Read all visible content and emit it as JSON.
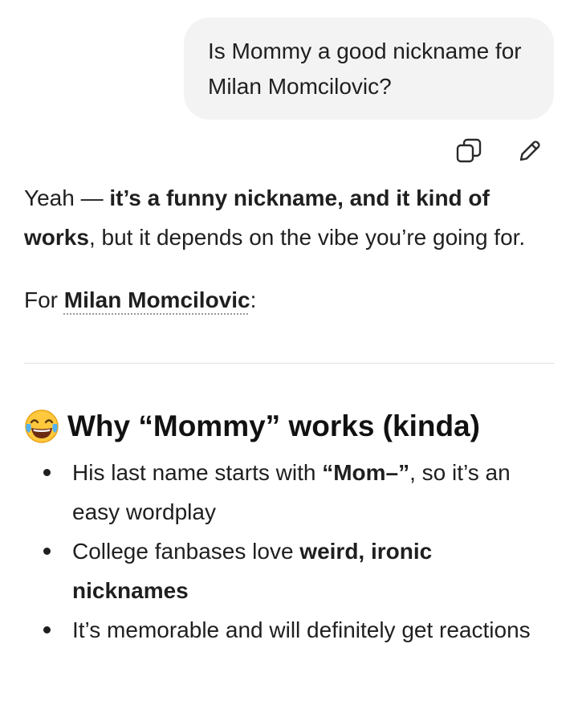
{
  "user_message": {
    "text": "Is Mommy a good nickname for Milan Momcilovic?"
  },
  "message_actions": {
    "copy_icon": "copy-icon",
    "edit_icon": "pencil-edit-icon"
  },
  "reply": {
    "para1": {
      "lead": "Yeah — ",
      "bold": "it’s a funny nickname, and it kind of works",
      "rest": ", but it depends on the vibe you’re going for."
    },
    "para2": {
      "lead": "For ",
      "link": "Milan Momcilovic",
      "trail": ":"
    }
  },
  "section": {
    "emoji": "face-with-tears-of-joy",
    "heading": "Why “Mommy” works (kinda)"
  },
  "bullets": [
    {
      "pre": "His last name starts with ",
      "bold": "“Mom–”",
      "post": ", so it’s an easy wordplay"
    },
    {
      "pre": "College fanbases love ",
      "bold": "weird, ironic nicknames",
      "post": ""
    },
    {
      "pre": "It’s memorable and will definitely get reactions",
      "bold": "",
      "post": ""
    }
  ]
}
